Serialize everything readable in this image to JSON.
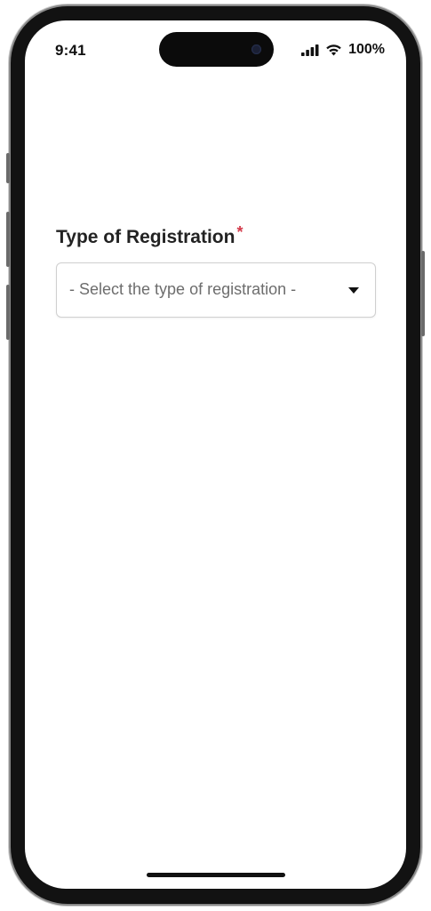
{
  "status_bar": {
    "time": "9:41",
    "battery": "100%",
    "icons": [
      "cellular-signal-icon",
      "wifi-icon"
    ]
  },
  "form": {
    "registration_type": {
      "label": "Type of Registration",
      "required_marker": "*",
      "placeholder": "- Select the type of registration -",
      "icon": "caret-down-icon"
    }
  },
  "colors": {
    "required": "#d33a4a",
    "label": "#222222",
    "placeholder": "#6d6d6d",
    "border": "#cfcfcf"
  }
}
